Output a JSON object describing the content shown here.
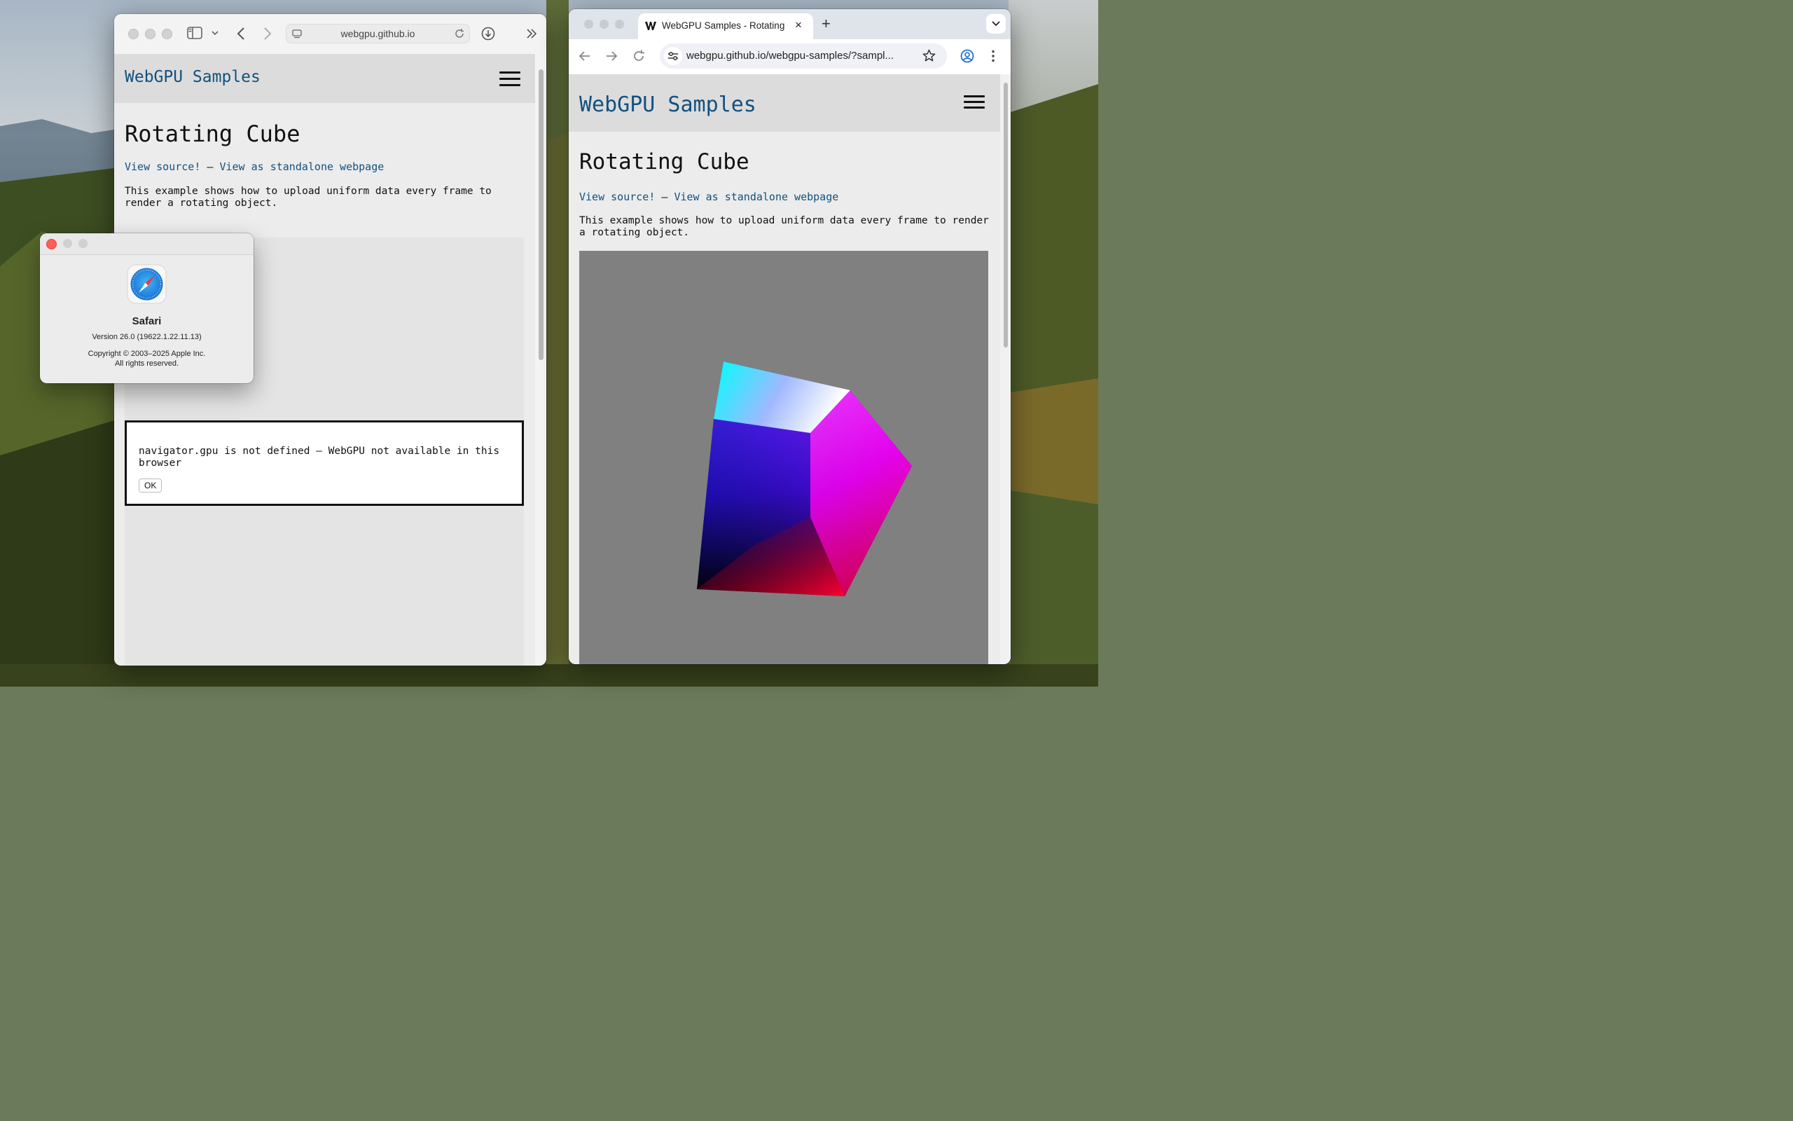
{
  "safari_window": {
    "url_display": "webgpu.github.io",
    "site_title": "WebGPU Samples",
    "page_title": "Rotating Cube",
    "link_view_source": "View source!",
    "link_separator": " – ",
    "link_standalone": "View as standalone webpage",
    "description": "This example shows how to upload uniform data every frame to render a rotating object.",
    "error_message": "navigator.gpu is not defined – WebGPU not available in this browser",
    "ok_button": "OK"
  },
  "about_panel": {
    "app_name": "Safari",
    "version": "Version 26.0 (19622.1.22.11.13)",
    "copyright_line1": "Copyright © 2003–2025 Apple Inc.",
    "copyright_line2": "All rights reserved."
  },
  "chrome_window": {
    "tab_title": "WebGPU Samples - Rotating Cube",
    "tab_close": "×",
    "new_tab": "+",
    "url": "webgpu.github.io/webgpu-samples/?sampl...",
    "site_title": "WebGPU Samples",
    "page_title": "Rotating Cube",
    "link_view_source": "View source!",
    "link_separator": " – ",
    "link_standalone": "View as standalone webpage",
    "description": "This example shows how to upload uniform data every frame to render a rotating object."
  },
  "colors": {
    "link": "#12517e",
    "canvas_background": "#808080",
    "close_red": "#ff5f57"
  },
  "icons": [
    "sidebar-icon",
    "chevron-down-icon",
    "back-arrow-icon",
    "forward-arrow-icon",
    "page-icon",
    "reload-icon",
    "download-icon",
    "overflow-chevrons-icon",
    "hamburger-menu-icon",
    "safari-compass-icon",
    "webgpu-favicon",
    "tab-search-icon",
    "tune-icon",
    "star-icon",
    "profile-icon",
    "kebab-menu-icon"
  ]
}
